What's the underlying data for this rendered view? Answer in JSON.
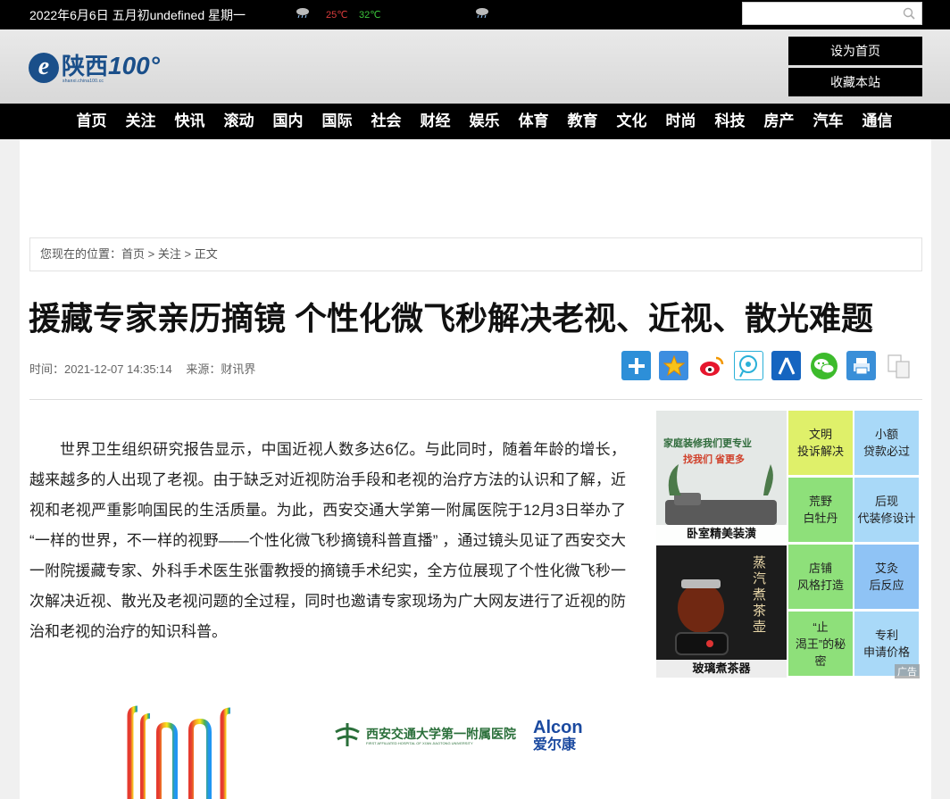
{
  "topbar": {
    "date": "2022年6月6日 五月初undefined 星期一",
    "temp_high": "25℃",
    "temp_low": "32℃",
    "search_placeholder": ""
  },
  "header": {
    "logo_cn": "陕西",
    "logo_num": "100°",
    "logo_sub": "shanxi.china100.cc",
    "btn_home": "设为首页",
    "btn_fav": "收藏本站"
  },
  "nav": [
    "首页",
    "关注",
    "快讯",
    "滚动",
    "国内",
    "国际",
    "社会",
    "财经",
    "娱乐",
    "体育",
    "教育",
    "文化",
    "时尚",
    "科技",
    "房产",
    "汽车",
    "通信"
  ],
  "breadcrumb": {
    "prefix": "您现在的位置：",
    "home": "首页",
    "sep": " > ",
    "section": "关注",
    "current": "正文"
  },
  "article": {
    "title": "援藏专家亲历摘镜 个性化微飞秒解决老视、近视、散光难题",
    "time": "时间：2021-12-07 14:35:14",
    "source": "来源：财讯界",
    "body": "世界卫生组织研究报告显示，中国近视人数多达6亿。与此同时，随着年龄的增长，越来越多的人出现了老视。由于缺乏对近视防治手段和老视的治疗方法的认识和了解，近视和老视严重影响国民的生活质量。为此，西安交通大学第一附属医院于12月3日举办了 “一样的世界，不一样的视野——个性化微飞秒摘镜科普直播” ，通过镜头见证了西安交大一附院援藏专家、外科手术医生张雷教授的摘镜手术纪实，全方位展现了个性化微飞秒一次解决近视、散光及老视问题的全过程，同时也邀请专家现场为广大网友进行了近视的防治和老视的治疗的知识科普。"
  },
  "share_icons": [
    "plus-icon",
    "qzone-icon",
    "weibo-icon",
    "tencent-weibo-icon",
    "renren-icon",
    "wechat-icon",
    "print-icon",
    "copy-icon"
  ],
  "ad": {
    "pic1_caption": "卧室精美装潢",
    "pic1_line1": "家庭装修我们更专业",
    "pic1_line2": "找我们 省更多",
    "pic2_caption": "玻璃煮茶器",
    "pic2_text": "蒸汽煮茶壶",
    "cells": [
      {
        "l1": "文明",
        "l2": "投诉解决"
      },
      {
        "l1": "小额",
        "l2": "贷款必过"
      },
      {
        "l1": "荒野",
        "l2": "白牡丹"
      },
      {
        "l1": "后现",
        "l2": "代装修设计"
      },
      {
        "l1": "店铺",
        "l2": "风格打造"
      },
      {
        "l1": "艾灸",
        "l2": "后反应"
      },
      {
        "l1": "“止",
        "l2": "渴王”的秘",
        "l3": "密"
      },
      {
        "l1": "专利",
        "l2": "申请价格"
      }
    ],
    "tag": "广告"
  },
  "logos": {
    "xjtu_cn": "西安交通大学第一附属医院",
    "xjtu_en": "FIRST AFFILIATED HOSPITAL OF XI'AN JIAOTONG UNIVERSITY",
    "alcon_en": "Alcon",
    "alcon_cn": "爱尔康"
  },
  "colors": {
    "nav_bg": "#000000",
    "brand_blue": "#1a4f8a",
    "temp_high": "#d93b3b",
    "temp_low": "#3bc43b"
  }
}
